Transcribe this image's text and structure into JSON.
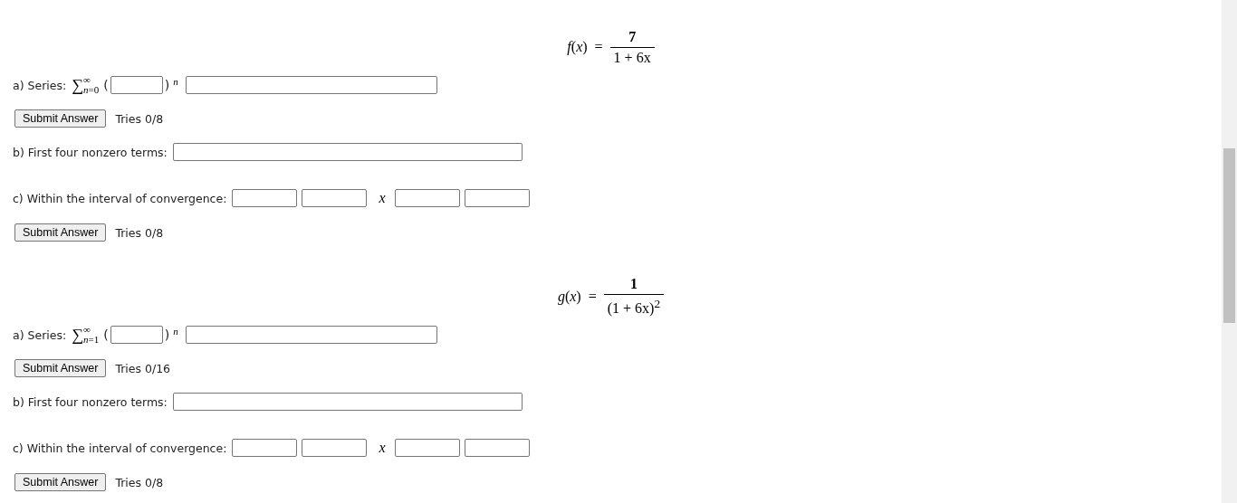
{
  "problems": [
    {
      "function": {
        "name": "*f*(*x*)",
        "equals": "=",
        "numerator": "7",
        "denominator": "1 + 6x"
      },
      "series": {
        "label": "a) Series:",
        "sigma": "∑",
        "sum_from": "*n*=0",
        "sum_to": "∞",
        "open": "(",
        "close": ")",
        "exponent": "n"
      },
      "submit_a": {
        "button": "Submit Answer",
        "tries": "Tries 0/8"
      },
      "terms": {
        "label": "b) First four nonzero terms:"
      },
      "interval": {
        "label": "c) Within the interval of convergence:",
        "variable": "x"
      },
      "submit_c": {
        "button": "Submit Answer",
        "tries": "Tries 0/8"
      }
    },
    {
      "function": {
        "name": "*g*(*x*)",
        "equals": "=",
        "numerator": "1",
        "denominator": "(1 + 6x)$^{2}$"
      },
      "series": {
        "label": "a) Series:",
        "sigma": "∑",
        "sum_from": "*n*=1",
        "sum_to": "∞",
        "open": "(",
        "close": ")",
        "exponent": "n"
      },
      "submit_a": {
        "button": "Submit Answer",
        "tries": "Tries 0/16"
      },
      "terms": {
        "label": "b) First four nonzero terms:"
      },
      "interval": {
        "label": "c) Within the interval of convergence:",
        "variable": "x"
      },
      "submit_c": {
        "button": "Submit Answer",
        "tries": "Tries 0/8"
      }
    }
  ]
}
